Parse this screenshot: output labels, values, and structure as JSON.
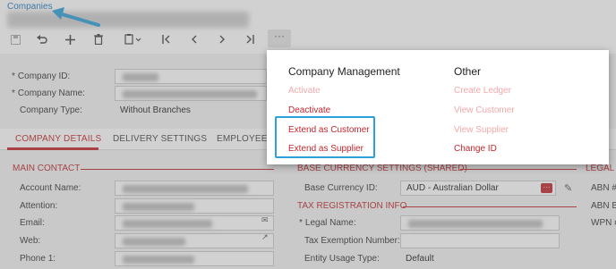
{
  "breadcrumb": "Companies",
  "toolbar": {
    "save_icon": "save-icon",
    "undo_icon": "undo-icon",
    "add_icon": "plus-icon",
    "delete_icon": "trash-icon",
    "copy_icon": "copy-icon",
    "first_icon": "first-icon",
    "prev_icon": "prev-icon",
    "next_icon": "next-icon",
    "last_icon": "last-icon",
    "more_label": "···"
  },
  "header_form": {
    "company_id_label": "Company ID:",
    "company_name_label": "Company Name:",
    "company_type_label": "Company Type:",
    "company_type_value": "Without Branches"
  },
  "tabs": [
    "COMPANY DETAILS",
    "DELIVERY SETTINGS",
    "EMPLOYEES"
  ],
  "main_contact": {
    "title": "MAIN CONTACT",
    "account_name_label": "Account Name:",
    "attention_label": "Attention:",
    "email_label": "Email:",
    "web_label": "Web:",
    "phone_label": "Phone 1:"
  },
  "base_currency": {
    "title": "BASE CURRENCY SETTINGS (SHARED)",
    "label": "Base Currency ID:",
    "value": "AUD - Australian Dollar"
  },
  "tax_registration": {
    "title": "TAX REGISTRATION INFO",
    "legal_name_label": "Legal Name:",
    "tax_exemption_label": "Tax Exemption Number:",
    "entity_usage_label": "Entity Usage Type:",
    "entity_usage_value": "Default"
  },
  "legal_section": {
    "title": "LEGAL I",
    "abn_label": "ABN #",
    "abn2_label": "ABN B",
    "wpn_label": "WPN #"
  },
  "menu": {
    "company_management_title": "Company Management",
    "other_title": "Other",
    "company_management_items": [
      {
        "label": "Activate",
        "enabled": false
      },
      {
        "label": "Deactivate",
        "enabled": true
      },
      {
        "label": "Extend as Customer",
        "enabled": true
      },
      {
        "label": "Extend as Supplier",
        "enabled": true
      }
    ],
    "other_items": [
      {
        "label": "Create Ledger",
        "enabled": false
      },
      {
        "label": "View Customer",
        "enabled": false
      },
      {
        "label": "View Supplier",
        "enabled": false
      },
      {
        "label": "Change ID",
        "enabled": true
      }
    ]
  },
  "colors": {
    "accent_red": "#c1272d",
    "highlight_blue": "#2d9fd9",
    "link_blue": "#1e76bb"
  }
}
